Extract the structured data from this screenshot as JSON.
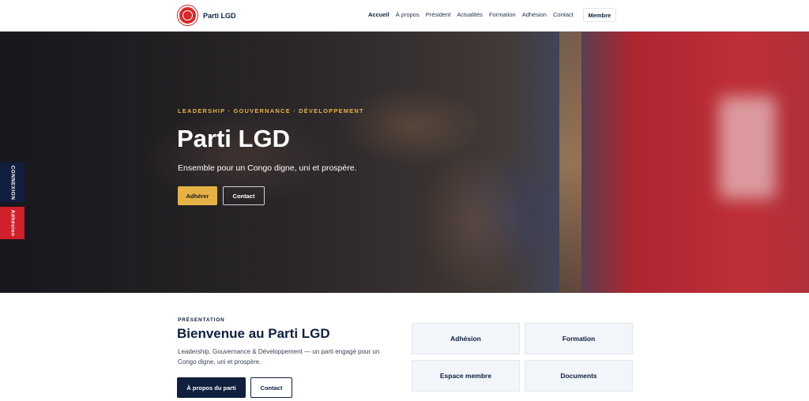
{
  "header": {
    "brand_name": "Parti LGD",
    "nav": [
      {
        "label": "Accueil"
      },
      {
        "label": "À propos"
      },
      {
        "label": "Président"
      },
      {
        "label": "Actualités"
      },
      {
        "label": "Formation"
      },
      {
        "label": "Adhésion"
      },
      {
        "label": "Contact"
      }
    ],
    "member_button": "Membre"
  },
  "hero": {
    "tagline": "LEADERSHIP · GOUVERNANCE · DÉVELOPPEMENT",
    "title": "Parti LGD",
    "subtitle": "Ensemble pour un Congo digne, uni et prospère.",
    "join_button": "Adhérer",
    "contact_button": "Contact"
  },
  "side_tabs": {
    "connexion": "CONNEXION",
    "adhesion": "Adhésion"
  },
  "presentation": {
    "label": "PRÉSENTATION",
    "title": "Bienvenue au Parti LGD",
    "text": "Leadership, Gouvernance & Développement — un parti engagé pour un Congo digne, uni et prospère.",
    "about_button": "À propos du parti",
    "contact_button": "Contact"
  },
  "cards": [
    {
      "label": "Adhésion"
    },
    {
      "label": "Formation"
    },
    {
      "label": "Espace membre"
    },
    {
      "label": "Documents"
    }
  ],
  "colors": {
    "navy": "#0f1f3d",
    "gold": "#e6b246",
    "red": "#d0202c"
  },
  "icons": {
    "logo": "party-emblem-icon"
  }
}
